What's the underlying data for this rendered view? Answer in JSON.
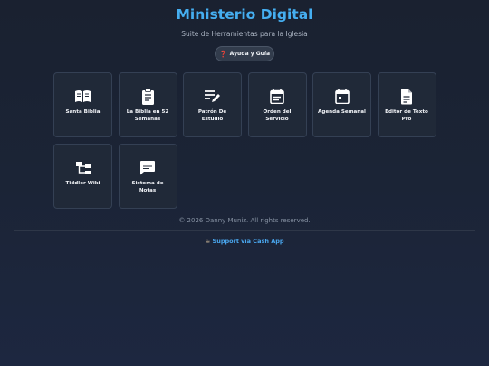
{
  "header": {
    "title": "Ministerio Digital",
    "subtitle": "Suite de Herramientas para la Iglesia",
    "help_icon": "❓",
    "help_label": "Ayuda y Guía"
  },
  "apps": [
    {
      "label": "Santa Biblia",
      "icon": "book-open-icon"
    },
    {
      "label": "La Biblia en 52 Semanas",
      "icon": "clipboard-icon"
    },
    {
      "label": "Patrón De Estudio",
      "icon": "list-edit-icon"
    },
    {
      "label": "Orden del Servicio",
      "icon": "calendar-list-icon"
    },
    {
      "label": "Agenda Semanal",
      "icon": "calendar-icon"
    },
    {
      "label": "Editor de Texto Pro",
      "icon": "document-icon"
    },
    {
      "label": "Tiddler Wiki",
      "icon": "tree-icon"
    },
    {
      "label": "Sistema de Notas",
      "icon": "notes-icon"
    }
  ],
  "footer": {
    "copyright": "© 2026 Danny Muniz. All rights reserved.",
    "support_icon": "☕",
    "support_label": "Support via Cash App"
  }
}
